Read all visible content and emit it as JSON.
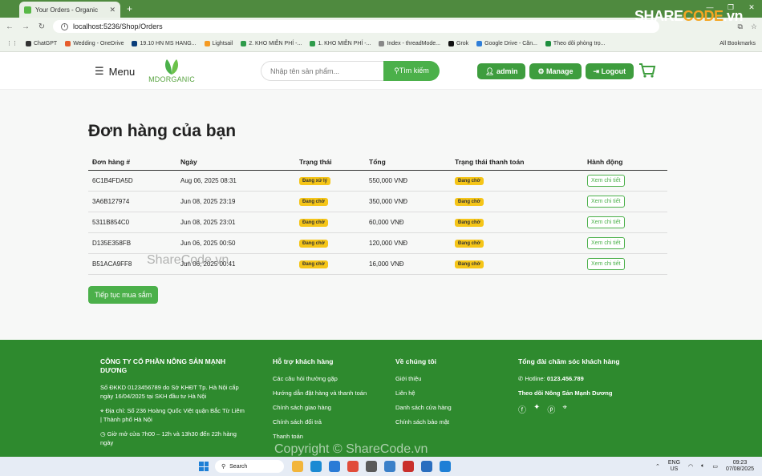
{
  "browser": {
    "tab_title": "Your Orders - Organic",
    "url": "localhost:5236/Shop/Orders",
    "bookmarks": [
      "ChatGPT",
      "Wedding - OneDrive",
      "19.10 HN MS HANG...",
      "Lightsail",
      "2. KHO MIỄN PHÍ -...",
      "1. KHO MIỄN PHÍ -...",
      "Index - threadMode...",
      "Grok",
      "Google Drive - Căn...",
      "Theo dõi phòng trọ..."
    ],
    "all_bookmarks": "All Bookmarks"
  },
  "watermark": {
    "logo_share": "SHARE",
    "logo_code": "CODE",
    "logo_suffix": ".vn",
    "mid_text": "ShareCode.vn",
    "bottom_text": "Copyright © ShareCode.vn"
  },
  "header": {
    "menu_label": "Menu",
    "brand_md": "MD",
    "brand_organic": "ORGANIC",
    "search_placeholder": "Nhập tên sản phẩm...",
    "search_button": "Tìm kiếm",
    "admin_label": "admin",
    "manage_label": "Manage",
    "logout_label": "Logout"
  },
  "main": {
    "title": "Đơn hàng của bạn",
    "columns": [
      "Đơn hàng #",
      "Ngày",
      "Trạng thái",
      "Tổng",
      "Trạng thái thanh toán",
      "Hành động"
    ],
    "orders": [
      {
        "id": "6C1B4FDA5D",
        "date": "Aug 06, 2025 08:31",
        "status": "Đang xử lý",
        "total": "550,000 VNĐ",
        "payment": "Đang chờ",
        "action": "Xem chi tiết"
      },
      {
        "id": "3A6B127974",
        "date": "Jun 08, 2025 23:19",
        "status": "Đang chờ",
        "total": "350,000 VNĐ",
        "payment": "Đang chờ",
        "action": "Xem chi tiết"
      },
      {
        "id": "5311B854C0",
        "date": "Jun 08, 2025 23:01",
        "status": "Đang chờ",
        "total": "60,000 VNĐ",
        "payment": "Đang chờ",
        "action": "Xem chi tiết"
      },
      {
        "id": "D135E358FB",
        "date": "Jun 06, 2025 00:50",
        "status": "Đang chờ",
        "total": "120,000 VNĐ",
        "payment": "Đang chờ",
        "action": "Xem chi tiết"
      },
      {
        "id": "B51ACA9FF8",
        "date": "Jun 06, 2025 00:41",
        "status": "Đang chờ",
        "total": "16,000 VNĐ",
        "payment": "Đang chờ",
        "action": "Xem chi tiết"
      }
    ],
    "continue_button": "Tiếp tục mua sắm"
  },
  "footer": {
    "company": {
      "title": "CÔNG TY CỔ PHẦN NÔNG SẢN MẠNH DƯƠNG",
      "reg": "Số ĐKKD 0123456789 do Sở KHĐT Tp. Hà Nội cấp ngày 16/04/2025 tại SKH đầu tư Hà Nội",
      "address": "Địa chỉ: Số 236 Hoàng Quốc Việt quận Bắc Từ Liêm | Thành phố Hà Nội",
      "hours": "Giờ mở cửa 7h00 – 12h và 13h30 đến 22h hàng ngày"
    },
    "support": {
      "title": "Hỗ trợ khách hàng",
      "links": [
        "Các câu hỏi thường gặp",
        "Hướng dẫn đặt hàng và thanh toán",
        "Chính sách giao hàng",
        "Chính sách đổi trả",
        "Thanh toán"
      ]
    },
    "about": {
      "title": "Về chúng tôi",
      "links": [
        "Giới thiệu",
        "Liên hệ",
        "Danh sách cửa hàng",
        "Chính sách bảo mật"
      ]
    },
    "care": {
      "title": "Tổng đài chăm sóc khách hàng",
      "hotline_label": "Hotline: ",
      "hotline": "0123.456.789",
      "follow": "Theo dõi Nông Sản Mạnh Dương"
    }
  },
  "taskbar": {
    "search": "Search",
    "lang_1": "ENG",
    "lang_2": "US",
    "time": "09:23",
    "date": "07/08/2025"
  }
}
